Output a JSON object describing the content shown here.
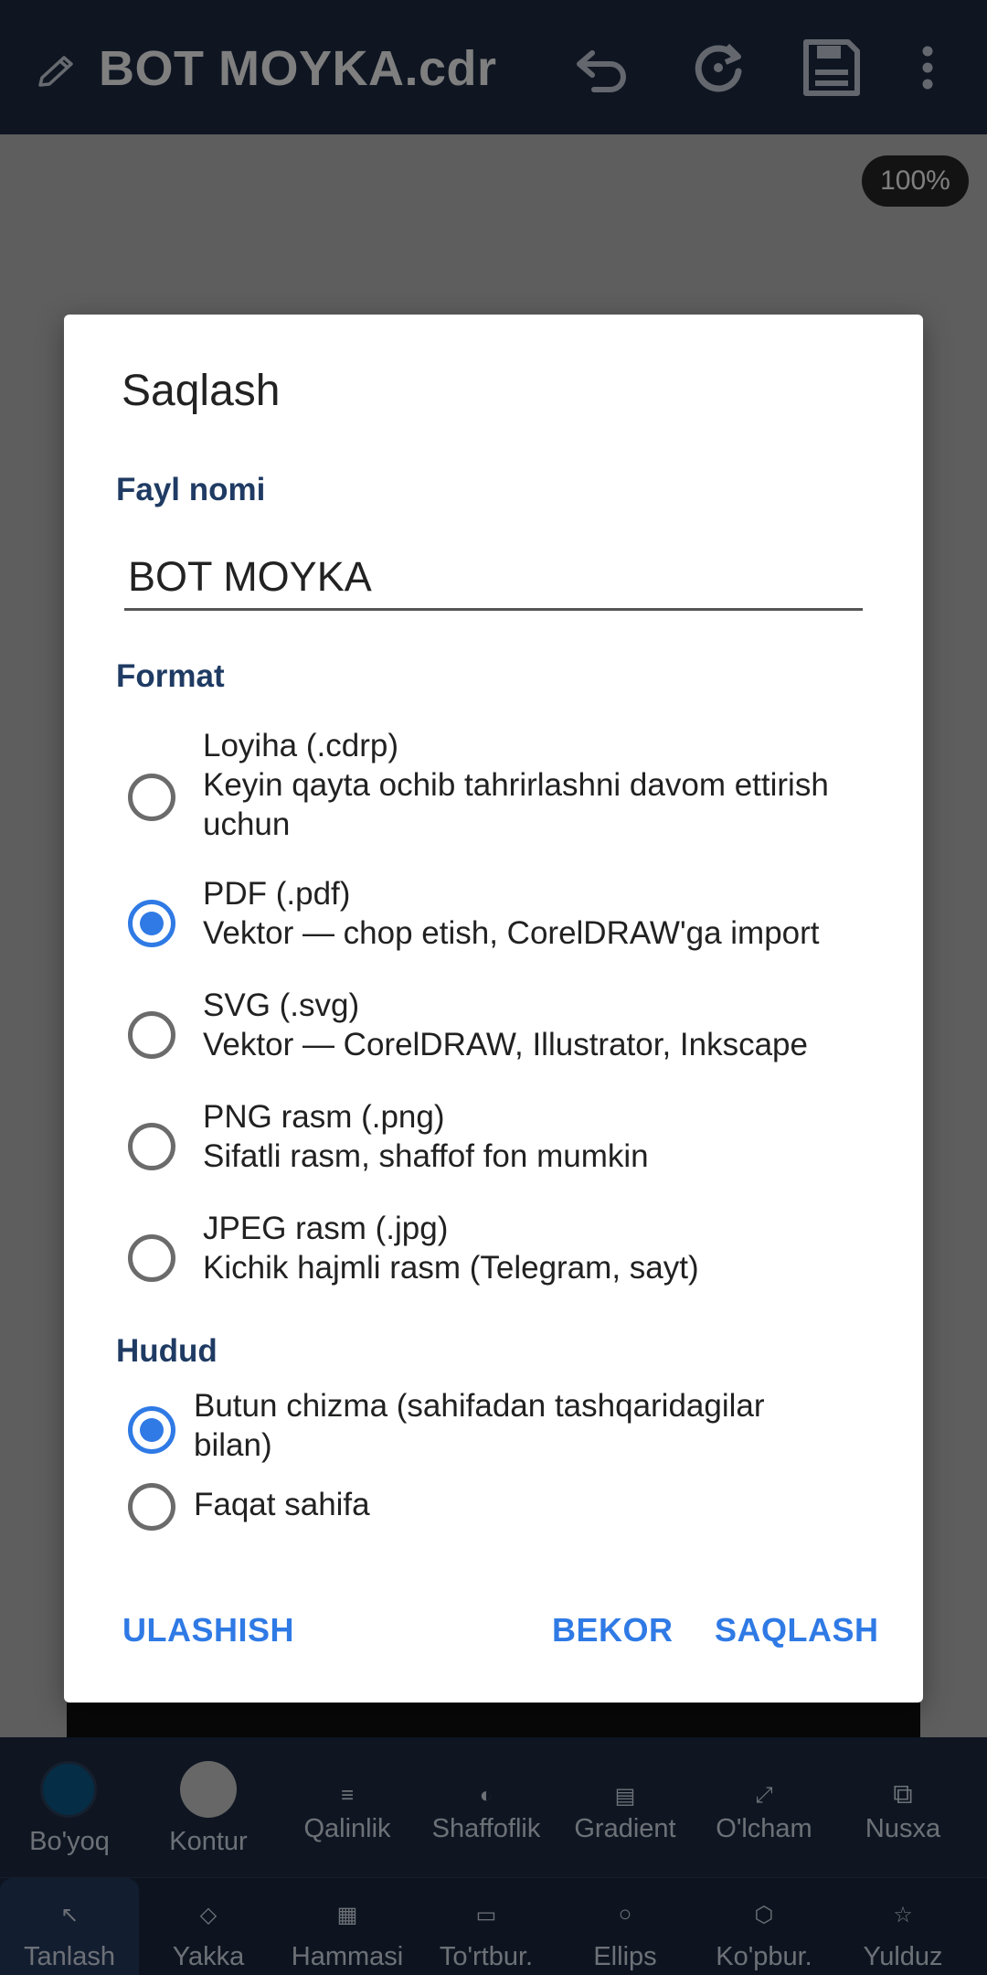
{
  "app": {
    "title": "BOT MOYKA.cdr",
    "icons": [
      "pencil-icon",
      "undo-icon",
      "redo-icon",
      "save-icon",
      "more-vert-icon"
    ],
    "zoom": "100%"
  },
  "dialog": {
    "title": "Saqlash",
    "filename_label": "Fayl nomi",
    "filename_value": "BOT MOYKA",
    "format_label": "Format",
    "formats": [
      {
        "name": "Loyiha  (.cdrp)",
        "desc": "Keyin qayta ochib tahrirlashni davom ettirish uchun",
        "selected": false
      },
      {
        "name": "PDF  (.pdf)",
        "desc": "Vektor — chop etish, CorelDRAW'ga import",
        "selected": true
      },
      {
        "name": "SVG  (.svg)",
        "desc": "Vektor — CorelDRAW, Illustrator, Inkscape",
        "selected": false
      },
      {
        "name": "PNG rasm  (.png)",
        "desc": "Sifatli rasm, shaffof fon mumkin",
        "selected": false
      },
      {
        "name": "JPEG rasm  (.jpg)",
        "desc": "Kichik hajmli rasm (Telegram, sayt)",
        "selected": false
      }
    ],
    "region_label": "Hudud",
    "regions": [
      {
        "label": "Butun chizma (sahifadan tashqaridagilar bilan)",
        "selected": true
      },
      {
        "label": "Faqat sahifa",
        "selected": false
      }
    ],
    "buttons": {
      "share": "ULASHISH",
      "cancel": "BEKOR",
      "save": "SAQLASH"
    },
    "accent_color": "#2f7ae5",
    "section_color": "#1f3b63"
  },
  "toolbar_top": [
    {
      "label": "Bo'yoq",
      "icon": "fill-color-swatch"
    },
    {
      "label": "Kontur",
      "icon": "stroke-color-swatch"
    },
    {
      "label": "Qalinlik",
      "icon": "line-width-icon"
    },
    {
      "label": "Shaffoflik",
      "icon": "opacity-icon"
    },
    {
      "label": "Gradient",
      "icon": "gradient-icon"
    },
    {
      "label": "O'lcham",
      "icon": "resize-icon"
    },
    {
      "label": "Nusxa",
      "icon": "copy-icon"
    }
  ],
  "toolbar_bottom": [
    {
      "label": "Tanlash",
      "icon": "select-arrow-icon",
      "active": true
    },
    {
      "label": "Yakka",
      "icon": "node-icon",
      "active": false
    },
    {
      "label": "Hammasi",
      "icon": "select-all-icon",
      "active": false
    },
    {
      "label": "To'rtbur.",
      "icon": "rectangle-icon",
      "active": false
    },
    {
      "label": "Ellips",
      "icon": "ellipse-icon",
      "active": false
    },
    {
      "label": "Ko'pbur.",
      "icon": "polygon-icon",
      "active": false
    },
    {
      "label": "Yulduz",
      "icon": "star-icon",
      "active": false
    }
  ],
  "colors": {
    "appbar": "#1e2d45",
    "fill_swatch": "#0b5a8a",
    "stroke_swatch": "#cfcfcf"
  }
}
